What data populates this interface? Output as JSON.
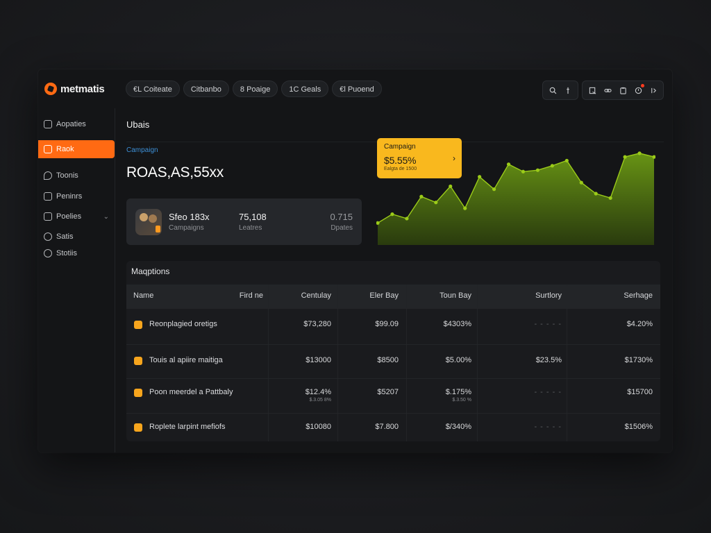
{
  "app": {
    "logo_text": "metmatis"
  },
  "tabs": [
    "€L Coiteate",
    "Citbanbo",
    "8 Poaige",
    "1C Geals",
    "€l Puoend"
  ],
  "sidebar": {
    "items": [
      {
        "label": "Aopaties"
      },
      {
        "label": "Raok",
        "active": true
      },
      {
        "label": "Toonis"
      },
      {
        "label": "Peninrs"
      },
      {
        "label": "Poelies",
        "has_chevron": true
      },
      {
        "label": "Satis"
      },
      {
        "label": "Stotiis"
      }
    ]
  },
  "main": {
    "title": "Ubais",
    "campaign_label": "Campaign",
    "big_metric": "ROAS,AS,55xx"
  },
  "stats": [
    {
      "value": "Sfeo 183x",
      "label": "Campaigns"
    },
    {
      "value": "75,108",
      "label": "Leatres"
    },
    {
      "value": "0.715",
      "label": "Dpates"
    }
  ],
  "tooltip": {
    "title": "Campaign",
    "value": "$5.55%",
    "sub": "Ealgta de 1500"
  },
  "chart_data": {
    "type": "area",
    "x": [
      0,
      1,
      2,
      3,
      4,
      5,
      6,
      7,
      8,
      9,
      10,
      11,
      12,
      13,
      14,
      15,
      16,
      17,
      18,
      19
    ],
    "values": [
      30,
      42,
      36,
      66,
      58,
      80,
      50,
      93,
      76,
      110,
      100,
      102,
      108,
      115,
      85,
      70,
      64,
      120,
      125,
      120
    ],
    "ylim": [
      0,
      140
    ],
    "color": "#9bcb19"
  },
  "table": {
    "title": "Maqptions",
    "columns": [
      "Name",
      "Fird ne",
      "Centulay",
      "Eler Bay",
      "Toun Bay",
      "Surtlory",
      "Serhage"
    ],
    "rows": [
      {
        "name": "Reonplagied oretigs",
        "c3": "$73,280",
        "c4": "$99.09",
        "c5": "$4303%",
        "c6": "- - - - -",
        "c7": "$4.20%"
      },
      {
        "name": "Touis al apiire maitiga",
        "c3": "$13000",
        "c4": "$8500",
        "c5": "$5.00%",
        "c6": "$23.5%",
        "c7": "$1730%"
      },
      {
        "name": "Poon meerdel a Pattbaly",
        "c3": "$12.4%",
        "c3s": "$.3.05 8%",
        "c4": "$5207",
        "c5": "$.175%",
        "c5s": "$.3.50 %",
        "c6": "- - - - -",
        "c7": "$15700"
      },
      {
        "name": "Roplete larpint mefiofs",
        "c3": "$10080",
        "c4": "$7.800",
        "c5": "$/340%",
        "c6": "- - - - -",
        "c7": "$1506%"
      }
    ]
  }
}
